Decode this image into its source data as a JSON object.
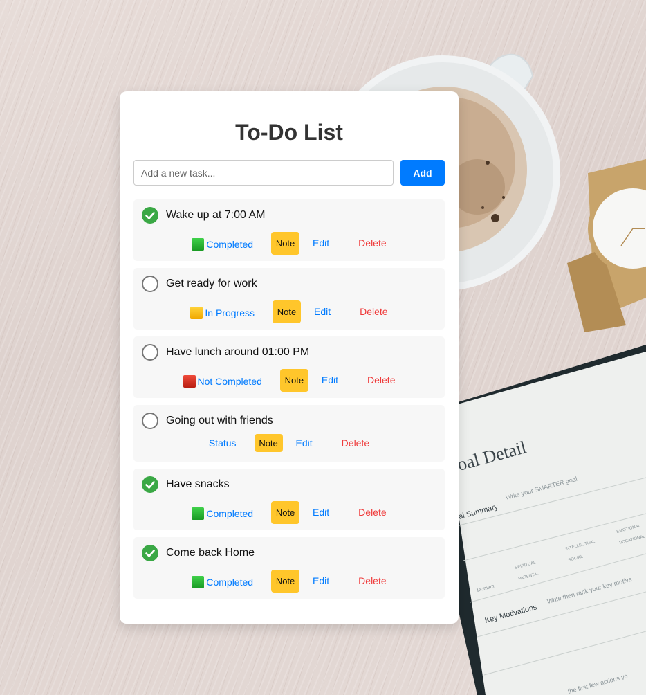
{
  "app": {
    "title": "To-Do List"
  },
  "add_task": {
    "placeholder": "Add a new task...",
    "button_label": "Add"
  },
  "colors": {
    "accent": "#007bff",
    "note": "#ffc62b",
    "delete": "#ef3b3b",
    "done_check": "#3aa845"
  },
  "action_labels": {
    "note": "Note",
    "edit": "Edit",
    "delete": "Delete"
  },
  "tasks": [
    {
      "title": "Wake up at 7:00 AM",
      "done": true,
      "status_label": "Completed",
      "status_color": "green"
    },
    {
      "title": "Get ready for work",
      "done": false,
      "status_label": "In Progress",
      "status_color": "yellow"
    },
    {
      "title": "Have lunch around 01:00 PM",
      "done": false,
      "status_label": "Not Completed",
      "status_color": "red"
    },
    {
      "title": "Going out with friends",
      "done": false,
      "status_label": "Status",
      "status_color": "none"
    },
    {
      "title": "Have snacks",
      "done": true,
      "status_label": "Completed",
      "status_color": "green"
    },
    {
      "title": "Come back Home",
      "done": true,
      "status_label": "Completed",
      "status_color": "green"
    }
  ],
  "background": {
    "planner_heading": "oal Detail",
    "planner_summary": "al Summary",
    "planner_summary_hint": "Write your SMARTER goal",
    "planner_domain": "Domain",
    "planner_options": [
      "SPIRITUAL",
      "PARENTAL",
      "INTELLECTUAL",
      "SOCIAL",
      "EMOTIONAL",
      "VOCATIONAL"
    ],
    "planner_motivations": "Key Motivations",
    "planner_motivations_hint": "Write then rank your key motiva",
    "planner_footer_hint": "the first few actions yo"
  }
}
